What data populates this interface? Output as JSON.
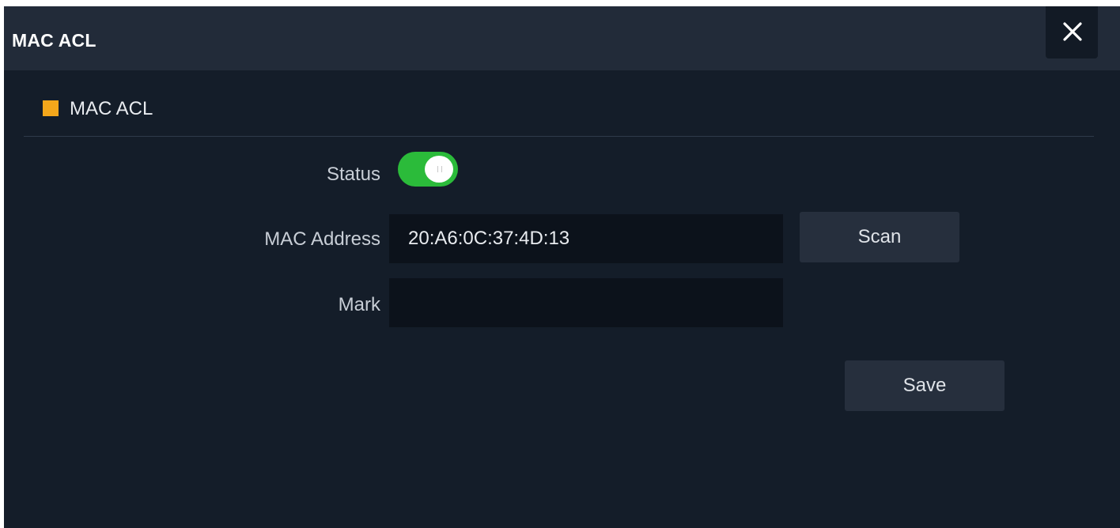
{
  "dialog": {
    "title": "MAC ACL",
    "close_glyph": "×"
  },
  "section": {
    "title": "MAC ACL",
    "marker_color": "#f4a71b"
  },
  "form": {
    "status": {
      "label": "Status",
      "enabled": true,
      "on_color": "#2bbb3a"
    },
    "mac_address": {
      "label": "MAC Address",
      "value": "20:A6:0C:37:4D:13",
      "placeholder": ""
    },
    "mark": {
      "label": "Mark",
      "value": "",
      "placeholder": ""
    },
    "scan_label": "Scan",
    "save_label": "Save"
  },
  "icons": {
    "close": "close-icon"
  }
}
